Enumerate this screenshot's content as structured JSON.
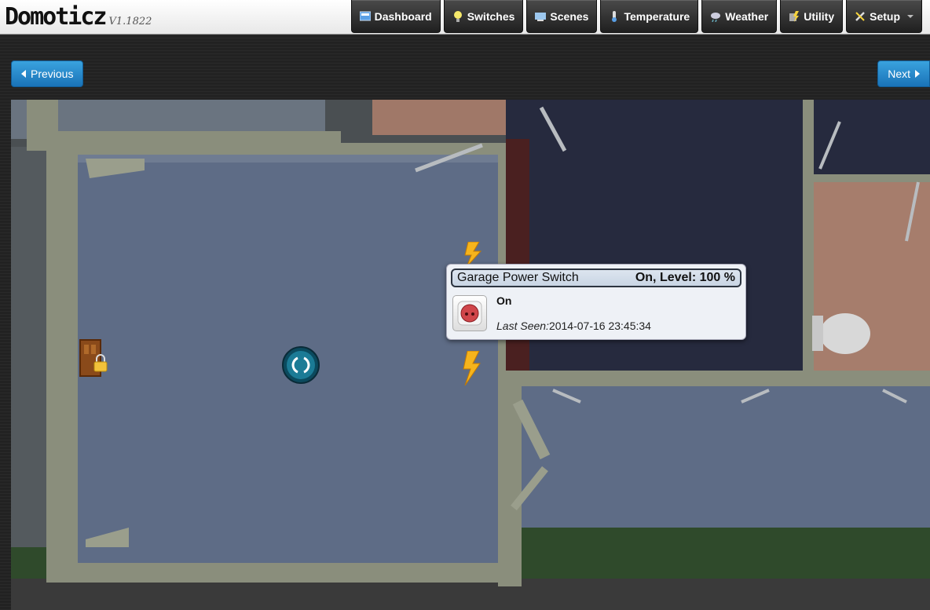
{
  "brand": {
    "name": "Domoticz",
    "version": "V1.1822"
  },
  "nav": [
    {
      "label": "Dashboard",
      "icon": "dashboard-icon"
    },
    {
      "label": "Switches",
      "icon": "lightbulb-icon"
    },
    {
      "label": "Scenes",
      "icon": "scenes-icon"
    },
    {
      "label": "Temperature",
      "icon": "thermometer-icon"
    },
    {
      "label": "Weather",
      "icon": "weather-icon"
    },
    {
      "label": "Utility",
      "icon": "utility-icon"
    },
    {
      "label": "Setup",
      "icon": "tools-icon"
    }
  ],
  "pager": {
    "previous": "Previous",
    "next": "Next"
  },
  "popup": {
    "device_name": "Garage Power Switch",
    "status": "On, Level: 100 %",
    "state": "On",
    "last_seen_label": "Last Seen:",
    "last_seen_value": "2014-07-16 23:45:34"
  },
  "colors": {
    "accent_blue": "#1a73b8",
    "nav_dark": "#1f1f1f",
    "room_floor": "#5b6b86",
    "wall": "#8a8f80"
  }
}
